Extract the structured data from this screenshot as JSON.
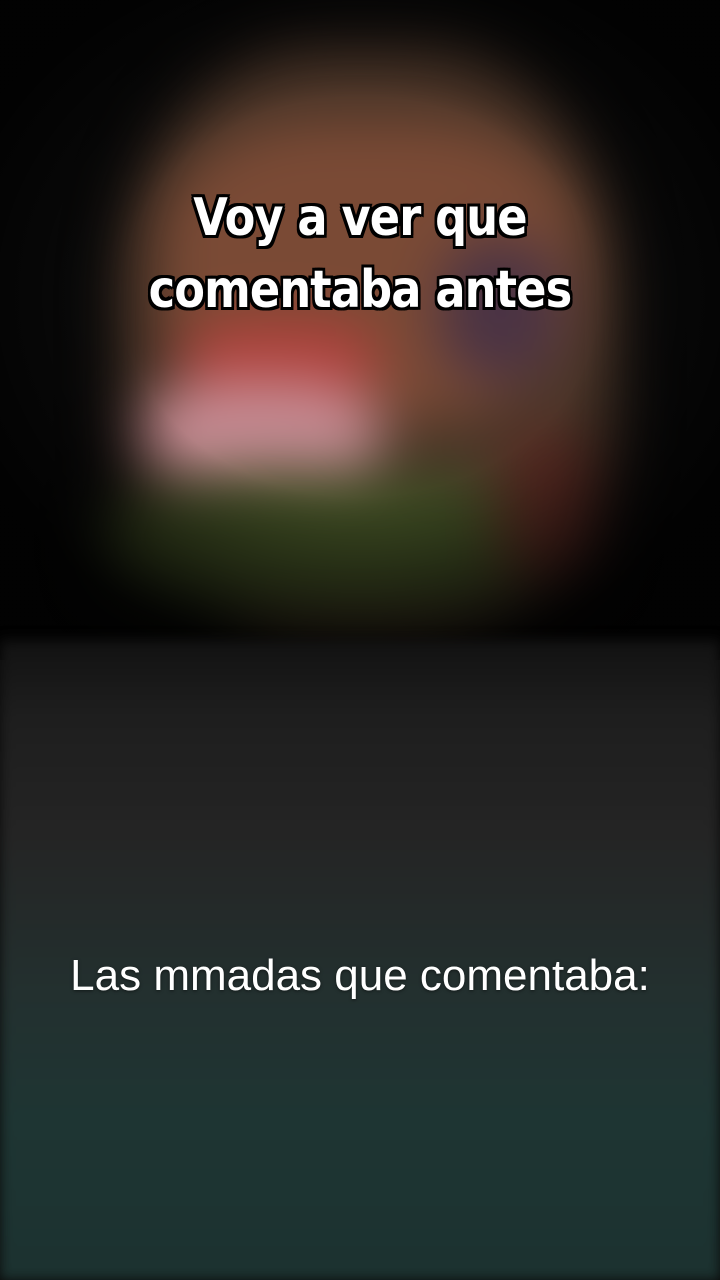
{
  "overlay_text": {
    "top_caption": "Voy a ver que comentaba antes",
    "bottom_caption": "Las mmadas que comentaba:"
  },
  "colors": {
    "background": "#0a0a0a",
    "text": "#ffffff",
    "text_outline": "#000000"
  }
}
